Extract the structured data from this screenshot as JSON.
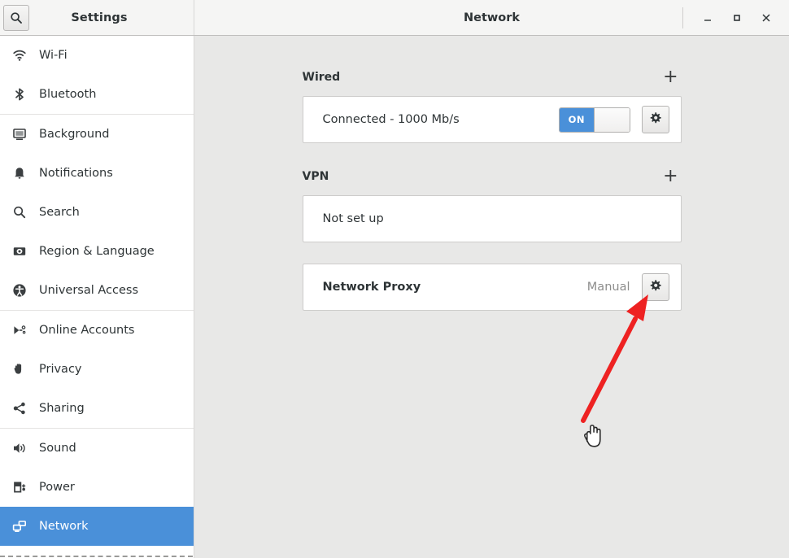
{
  "window": {
    "app_title": "Settings",
    "page_title": "Network",
    "search_icon": "search-icon",
    "controls": {
      "minimize": "_",
      "maximize": "□",
      "close": "✕"
    }
  },
  "sidebar": {
    "items": [
      {
        "label": "Wi-Fi",
        "icon": "wifi-icon",
        "active": false
      },
      {
        "label": "Bluetooth",
        "icon": "bluetooth-icon",
        "active": false
      },
      {
        "label": "Background",
        "icon": "background-icon",
        "active": false
      },
      {
        "label": "Notifications",
        "icon": "bell-icon",
        "active": false
      },
      {
        "label": "Search",
        "icon": "search-icon",
        "active": false
      },
      {
        "label": "Region & Language",
        "icon": "region-language-icon",
        "active": false
      },
      {
        "label": "Universal Access",
        "icon": "universal-access-icon",
        "active": false
      },
      {
        "label": "Online Accounts",
        "icon": "online-accounts-icon",
        "active": false
      },
      {
        "label": "Privacy",
        "icon": "privacy-hand-icon",
        "active": false
      },
      {
        "label": "Sharing",
        "icon": "sharing-icon",
        "active": false
      },
      {
        "label": "Sound",
        "icon": "sound-icon",
        "active": false
      },
      {
        "label": "Power",
        "icon": "power-battery-icon",
        "active": false
      },
      {
        "label": "Network",
        "icon": "network-icon",
        "active": true
      }
    ]
  },
  "main": {
    "sections": [
      {
        "title": "Wired",
        "add_label": "+",
        "row_label": "Connected - 1000 Mb/s",
        "toggle_label": "ON",
        "toggle_state": "on",
        "gear_icon": "gear-icon"
      },
      {
        "title": "VPN",
        "add_label": "+",
        "row_label": "Not set up"
      }
    ],
    "proxy": {
      "label": "Network Proxy",
      "value": "Manual",
      "gear_icon": "gear-icon"
    }
  },
  "annotation": {
    "arrow_color": "#ee2222",
    "cursor": "hand-pointer-cursor"
  },
  "colors": {
    "accent": "#4a90d9",
    "sidebar_bg": "#ffffff",
    "content_bg": "#e8e8e7",
    "titlebar_bg": "#f5f5f4",
    "text": "#2e3436",
    "muted_text": "#8d8d8c"
  }
}
